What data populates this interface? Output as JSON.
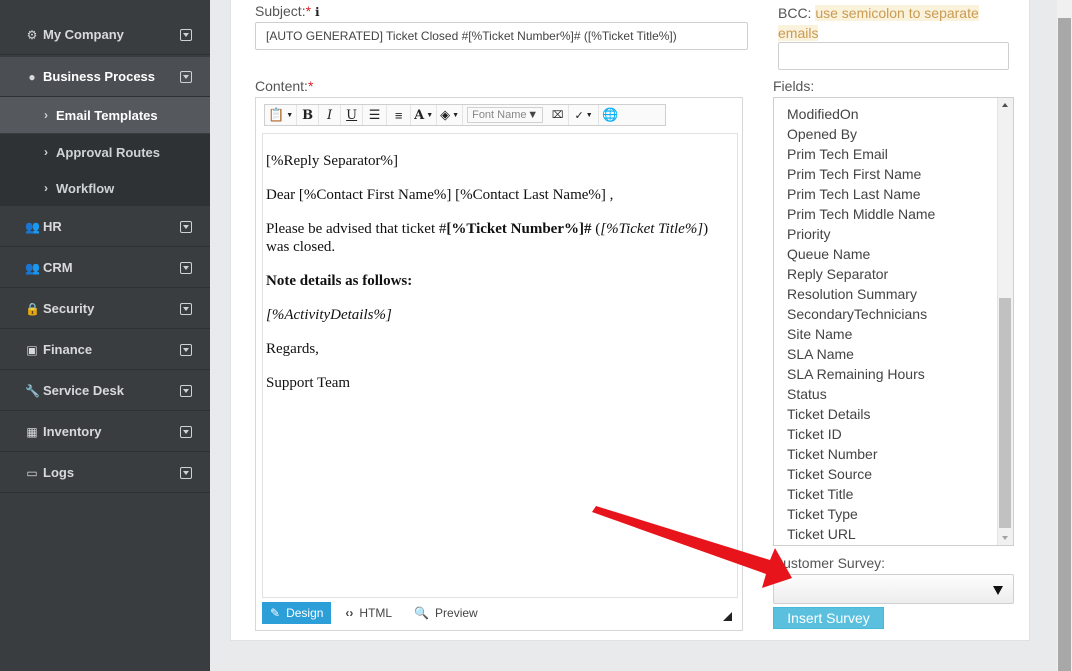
{
  "sidebar": {
    "items": [
      {
        "label": "My Company",
        "icon": "gear-icon"
      },
      {
        "label": "Business Process",
        "icon": "globe-icon"
      },
      {
        "label": "HR",
        "icon": "users-icon"
      },
      {
        "label": "CRM",
        "icon": "users-icon"
      },
      {
        "label": "Security",
        "icon": "lock-icon"
      },
      {
        "label": "Finance",
        "icon": "money-icon"
      },
      {
        "label": "Service Desk",
        "icon": "wrench-icon"
      },
      {
        "label": "Inventory",
        "icon": "building-icon"
      },
      {
        "label": "Logs",
        "icon": "inbox-icon"
      }
    ],
    "sub_items": [
      {
        "label": "Email Templates"
      },
      {
        "label": "Approval Routes"
      },
      {
        "label": "Workflow"
      }
    ]
  },
  "form": {
    "subject_label": "Subject:",
    "required_mark": "*",
    "info_glyph": "ℹ",
    "subject_value": "[AUTO GENERATED] Ticket Closed #[%Ticket Number%]# ([%Ticket Title%])",
    "bcc_label": "BCC:",
    "bcc_hint": "use semicolon to separate emails",
    "content_label": "Content:",
    "fields_label": "Fields:",
    "survey_label": "Customer Survey:",
    "insert_survey": "Insert Survey"
  },
  "editor": {
    "toolbar": {
      "bold": "B",
      "italic": "I",
      "underline": "U",
      "font_color": "A",
      "font_name": "Font Name"
    },
    "body": {
      "line1": "[%Reply Separator%]",
      "line2": "Dear [%Contact First Name%] [%Contact Last Name%] ,",
      "line3_pre": "Please be advised that ticket #",
      "line3_bold": "[%Ticket Number%]#",
      "line3_mid": " (",
      "line3_ital": "[%Ticket Title%]",
      "line3_post": ") was closed.",
      "line4": "Note details as follows:",
      "line5": "[%ActivityDetails%]",
      "line6": "Regards,",
      "line7": "Support Team"
    },
    "modes": {
      "design": "Design",
      "html": "HTML",
      "preview": "Preview"
    }
  },
  "fields": [
    "ModifiedOn",
    "Opened By",
    "Prim Tech Email",
    "Prim Tech First Name",
    "Prim Tech Last Name",
    "Prim Tech Middle Name",
    "Priority",
    "Queue Name",
    "Reply Separator",
    "Resolution Summary",
    "SecondaryTechnicians",
    "Site Name",
    "SLA Name",
    "SLA Remaining Hours",
    "Status",
    "Ticket Details",
    "Ticket ID",
    "Ticket Number",
    "Ticket Source",
    "Ticket Title",
    "Ticket Type",
    "Ticket URL"
  ],
  "colors": {
    "sidebar_bg": "#3a3d40",
    "accent": "#2c9fd8",
    "insert_button": "#5bc0de",
    "annotation_arrow": "#e8141b",
    "required": "#d9232f"
  }
}
